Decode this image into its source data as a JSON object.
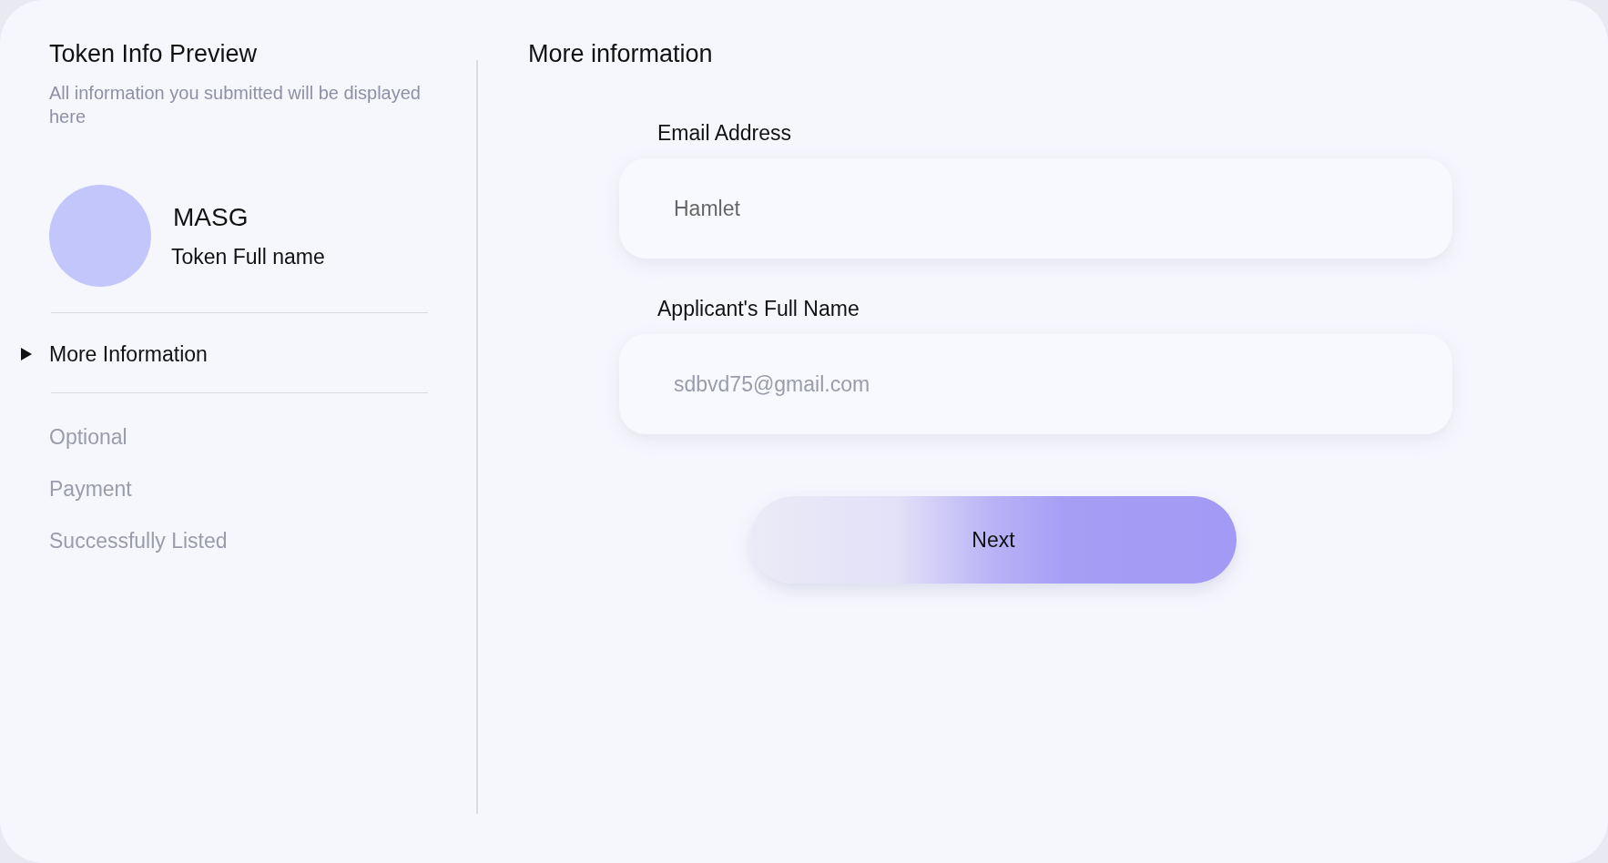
{
  "preview": {
    "title": "Token Info Preview",
    "subtitle": "All information you submitted will be displayed here",
    "token_symbol": "MASG",
    "token_name": "Token Full name"
  },
  "steps": [
    {
      "label": "More Information",
      "selected": true
    },
    {
      "label": "Optional",
      "selected": false
    },
    {
      "label": "Payment",
      "selected": false
    },
    {
      "label": "Successfully Listed",
      "selected": false
    }
  ],
  "form": {
    "title": "More information",
    "fields": [
      {
        "label": "Email Address",
        "value": "Hamlet"
      },
      {
        "label": "Applicant's Full Name",
        "placeholder": "sdbvd75@gmail.com"
      }
    ],
    "button": "Next"
  }
}
